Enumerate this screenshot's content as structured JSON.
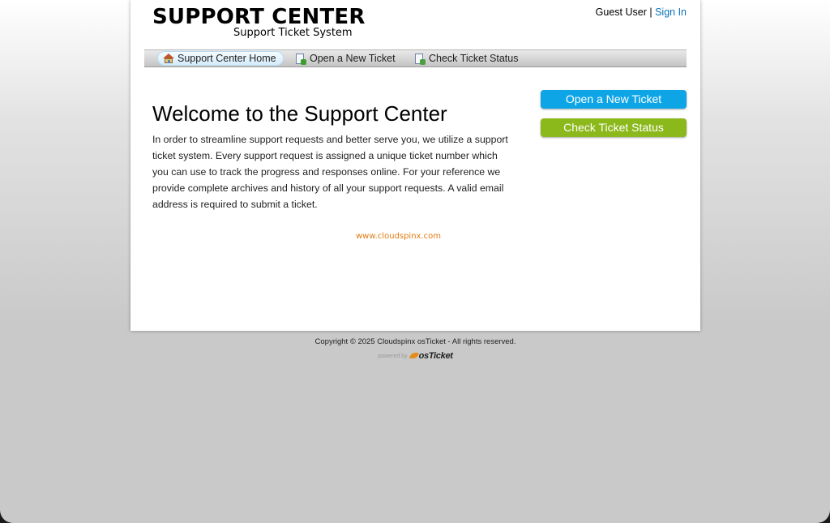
{
  "header": {
    "logo_title": "SUPPORT CENTER",
    "logo_subtitle": "Support Ticket System",
    "user_label": "Guest User",
    "separator": "|",
    "sign_in_label": "Sign In"
  },
  "nav": {
    "items": [
      {
        "label": "Support Center Home",
        "icon": "home-icon",
        "active": true
      },
      {
        "label": "Open a New Ticket",
        "icon": "new-ticket-icon",
        "active": false
      },
      {
        "label": "Check Ticket Status",
        "icon": "ticket-status-icon",
        "active": false
      }
    ]
  },
  "main": {
    "title": "Welcome to the Support Center",
    "intro": "In order to streamline support requests and better serve you, we utilize a support ticket system. Every support request is assigned a unique ticket number which you can use to track the progress and responses online. For your reference we provide complete archives and history of all your support requests. A valid email address is required to submit a ticket.",
    "link_text": "www.cloudspinx.com"
  },
  "sidebar": {
    "open_ticket_label": "Open a New Ticket",
    "check_status_label": "Check Ticket Status"
  },
  "footer": {
    "copyright": "Copyright © 2025 Cloudspinx osTicket - All rights reserved.",
    "powered_by": "powered by",
    "brand_prefix": "os",
    "brand_suffix": "Ticket"
  },
  "colors": {
    "link": "#0a72b8",
    "open_button": "#0ea5e6",
    "check_button": "#8bb81a",
    "site_link": "#e07a10"
  }
}
